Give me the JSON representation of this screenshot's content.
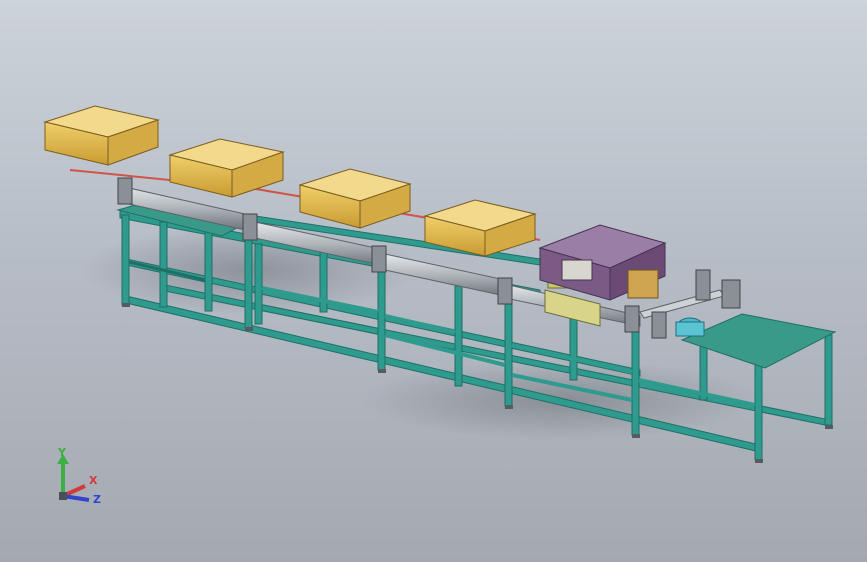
{
  "scene": {
    "subject": "cad-model-conveyor-line",
    "background_top": "#cdd3da",
    "background_bottom": "#a4a9b1",
    "frame_color": "#2f9a8e",
    "bin_color": "#e2bc52",
    "housing_color": "#7b5a86",
    "table_color": "#3a9a8a",
    "roller_color": "#aeb4b9"
  },
  "triad": {
    "x_label": "X",
    "y_label": "Y",
    "z_label": "Z",
    "x_color": "#d03c3c",
    "y_color": "#3cb043",
    "z_color": "#2f47c8"
  }
}
